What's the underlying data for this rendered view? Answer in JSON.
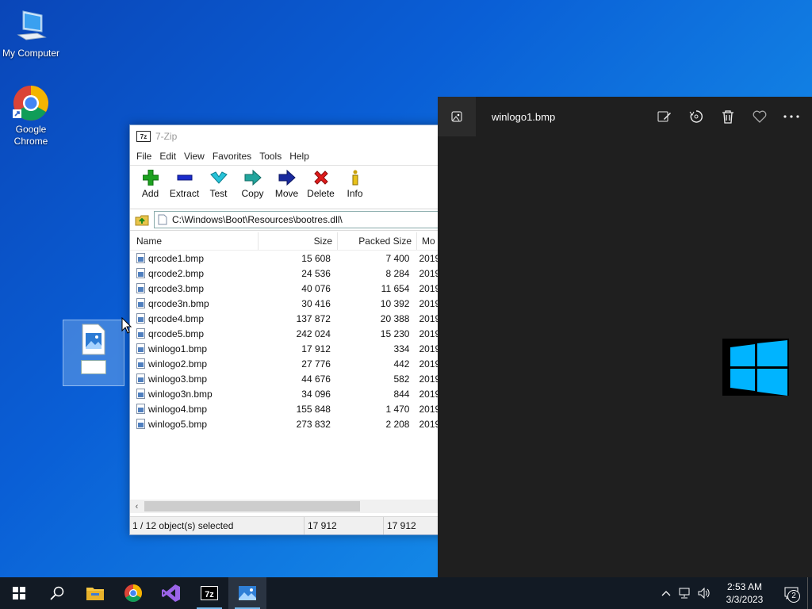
{
  "desktop": {
    "icons": [
      {
        "label": "My Computer",
        "icon": "my-computer-icon"
      },
      {
        "label_line1": "Google",
        "label_line2": "Chrome",
        "icon": "chrome-icon"
      }
    ]
  },
  "zip": {
    "title": "7-Zip",
    "logo": "7z",
    "menu": [
      "File",
      "Edit",
      "View",
      "Favorites",
      "Tools",
      "Help"
    ],
    "toolbar": [
      {
        "label": "Add",
        "icon": "add-icon"
      },
      {
        "label": "Extract",
        "icon": "extract-icon"
      },
      {
        "label": "Test",
        "icon": "test-icon"
      },
      {
        "label": "Copy",
        "icon": "copy-icon"
      },
      {
        "label": "Move",
        "icon": "move-icon"
      },
      {
        "label": "Delete",
        "icon": "delete-icon"
      },
      {
        "label": "Info",
        "icon": "info-icon"
      }
    ],
    "path": "C:\\Windows\\Boot\\Resources\\bootres.dll\\",
    "columns": [
      "Name",
      "Size",
      "Packed Size",
      "Mo"
    ],
    "rows": [
      {
        "name": "qrcode1.bmp",
        "size": "15 608",
        "packed": "7 400",
        "mod": "2019"
      },
      {
        "name": "qrcode2.bmp",
        "size": "24 536",
        "packed": "8 284",
        "mod": "2019"
      },
      {
        "name": "qrcode3.bmp",
        "size": "40 076",
        "packed": "11 654",
        "mod": "2019"
      },
      {
        "name": "qrcode3n.bmp",
        "size": "30 416",
        "packed": "10 392",
        "mod": "2019"
      },
      {
        "name": "qrcode4.bmp",
        "size": "137 872",
        "packed": "20 388",
        "mod": "2019"
      },
      {
        "name": "qrcode5.bmp",
        "size": "242 024",
        "packed": "15 230",
        "mod": "2019"
      },
      {
        "name": "winlogo1.bmp",
        "size": "17 912",
        "packed": "334",
        "mod": "2019"
      },
      {
        "name": "winlogo2.bmp",
        "size": "27 776",
        "packed": "442",
        "mod": "2019"
      },
      {
        "name": "winlogo3.bmp",
        "size": "44 676",
        "packed": "582",
        "mod": "2019"
      },
      {
        "name": "winlogo3n.bmp",
        "size": "34 096",
        "packed": "844",
        "mod": "2019"
      },
      {
        "name": "winlogo4.bmp",
        "size": "155 848",
        "packed": "1 470",
        "mod": "2019"
      },
      {
        "name": "winlogo5.bmp",
        "size": "273 832",
        "packed": "2 208",
        "mod": "2019"
      }
    ],
    "status": {
      "selected": "1 / 12 object(s) selected",
      "size": "17 912",
      "packed": "17 912"
    }
  },
  "photos": {
    "title": "winlogo1.bmp",
    "actions": [
      "edit-icon",
      "rotate-icon",
      "delete-icon",
      "favorite-icon",
      "more-icon"
    ],
    "logo_color": "#00b4ff"
  },
  "taskbar": {
    "apps": [
      "start-icon",
      "search-icon",
      "file-explorer-icon",
      "chrome-icon",
      "visual-studio-icon",
      "7zip-icon",
      "photos-icon"
    ],
    "time": "2:53 AM",
    "date": "3/3/2023",
    "notifications": "2"
  }
}
